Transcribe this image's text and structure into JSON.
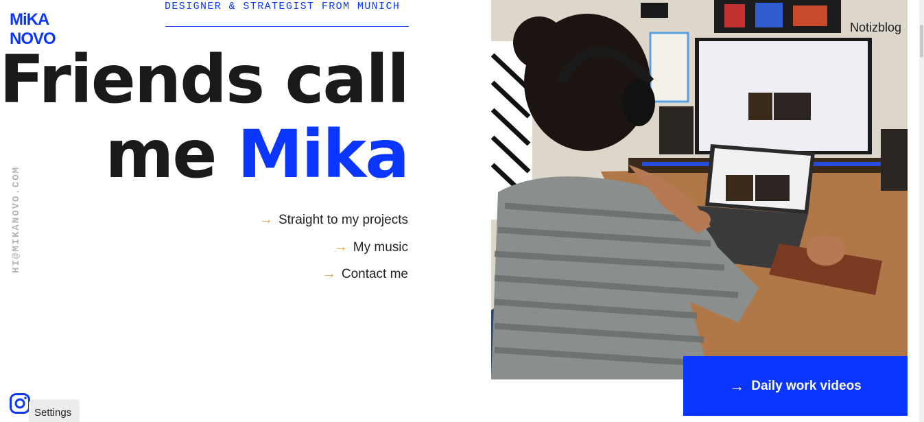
{
  "brand": {
    "logo_line1": "MiKA",
    "logo_line2": "NOVO",
    "tagline": "DESIGNER & STRATEGIST FROM MUNICH",
    "side_email": "HI@MIKANOVO.COM"
  },
  "hero": {
    "line1": "Friends call",
    "line2_prefix": "me ",
    "line2_accent": "Mika"
  },
  "links": [
    {
      "arrow": "→",
      "label": "Straight to my projects"
    },
    {
      "arrow": "→",
      "label": "My music"
    },
    {
      "arrow": "→",
      "label": "Contact me"
    }
  ],
  "nav": {
    "blog": "Notizblog"
  },
  "cta": {
    "arrow": "→",
    "label": "Daily work videos"
  },
  "footer": {
    "settings_label": "Settings",
    "social_icon": "instagram-icon"
  },
  "colors": {
    "accent": "#0a36ff",
    "arrow": "#f2a23a",
    "text": "#1a1a1a",
    "muted": "#b4b4b4"
  }
}
